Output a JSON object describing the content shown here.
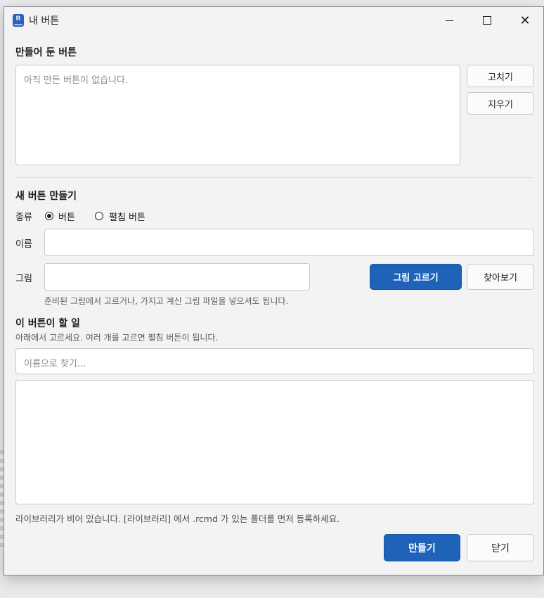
{
  "window": {
    "title": "내 버튼"
  },
  "saved": {
    "heading": "만들어 둔 버튼",
    "empty_text": "아직 만든 버튼이 없습니다.",
    "edit_label": "고치기",
    "delete_label": "지우기"
  },
  "create": {
    "heading": "새 버튼 만들기",
    "type_label": "종류",
    "type_options": [
      {
        "label": "버튼",
        "selected": true
      },
      {
        "label": "펼침 버튼",
        "selected": false
      }
    ],
    "name_label": "이름",
    "name_value": "",
    "image_label": "그림",
    "image_value": "",
    "pick_image_label": "그림 고르기",
    "browse_label": "찾아보기",
    "image_hint": "준비된 그림에서 고르거나, 가지고 계신 그림 파일을 넣으셔도 됩니다."
  },
  "action": {
    "heading": "이 버튼이 할 일",
    "hint": "아래에서 고르세요. 여러 개를 고르면 펼침 버튼이 됩니다.",
    "search_placeholder": "이름으로 찾기...",
    "library_message": "라이브러리가 비어 있습니다. [라이브러리] 에서 .rcmd 가 있는 폴더를 먼저 등록하세요."
  },
  "footer": {
    "create_label": "만들기",
    "close_label": "닫기"
  },
  "colors": {
    "primary": "#1e63b8",
    "window_bg": "#f3f3f3"
  }
}
